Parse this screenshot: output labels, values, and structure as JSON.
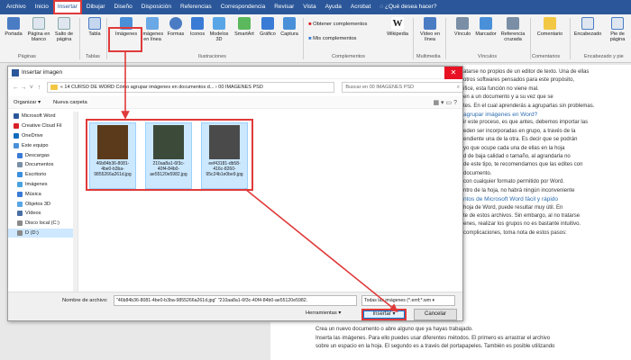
{
  "ribbon": {
    "tabs": [
      "Archivo",
      "Inicio",
      "Insertar",
      "Dibujar",
      "Diseño",
      "Disposición",
      "Referencias",
      "Correspondencia",
      "Revisar",
      "Vista",
      "Ayuda",
      "Acrobat"
    ],
    "active_tab": "Insertar",
    "tell_me": "¿Qué desea hacer?",
    "buttons": {
      "portada": "Portada",
      "pagina_blanco": "Página en blanco",
      "salto_pagina": "Salto de página",
      "tabla": "Tabla",
      "imagenes": "Imágenes",
      "imagenes_linea": "Imágenes en línea",
      "formas": "Formas",
      "iconos": "Iconos",
      "modelos3d": "Modelos 3D",
      "smartart": "SmartArt",
      "grafico": "Gráfico",
      "captura": "Captura",
      "obtener": "Obtener complementos",
      "mis": "Mis complementos",
      "wikipedia": "Wikipedia",
      "video": "Vídeo en línea",
      "vinculo": "Vínculo",
      "marcador": "Marcador",
      "referencia": "Referencia cruzada",
      "comentario": "Comentario",
      "encabezado": "Encabezado",
      "pie": "Pie de página"
    },
    "groups": {
      "paginas": "Páginas",
      "tablas": "Tablas",
      "ilustraciones": "Ilustraciones",
      "complementos": "Complementos",
      "multimedia": "Multimedia",
      "vinculos": "Vínculos",
      "comentarios": "Comentarios",
      "encabezado": "Encabezado y pie"
    }
  },
  "dialog": {
    "title": "Insertar imagen",
    "close": "✕",
    "address": "« 14 CURSO DE WORD Cómo agrupar imágenes en documentos d...  ›  00 IMAGENES PSD",
    "search_placeholder": "Buscar en 00 IMAGENES PSD",
    "toolbar": {
      "organize": "Organizar ▾",
      "new_folder": "Nueva carpeta"
    },
    "nav_items": [
      {
        "label": "Microsoft Word",
        "icon": "word-icon",
        "color": "#2b579a"
      },
      {
        "label": "Creative Cloud Fil",
        "icon": "cloud-icon",
        "color": "#da1f26"
      },
      {
        "label": "OneDrive",
        "icon": "onedrive-icon",
        "color": "#0f6cbd"
      },
      {
        "label": "Este equipo",
        "icon": "computer-icon",
        "color": "#4a90d9"
      },
      {
        "label": "Descargas",
        "icon": "download-icon",
        "color": "#3a7bd5"
      },
      {
        "label": "Documentos",
        "icon": "documents-icon",
        "color": "#7a8fa6"
      },
      {
        "label": "Escritorio",
        "icon": "desktop-icon",
        "color": "#3a8fe0"
      },
      {
        "label": "Imágenes",
        "icon": "pictures-icon",
        "color": "#4aa3df"
      },
      {
        "label": "Música",
        "icon": "music-icon",
        "color": "#3a7bd5"
      },
      {
        "label": "Objetos 3D",
        "icon": "cube-icon",
        "color": "#58a6e6"
      },
      {
        "label": "Vídeos",
        "icon": "video-icon",
        "color": "#4a6fa5"
      },
      {
        "label": "Disco local (C:)",
        "icon": "drive-icon",
        "color": "#8a8a8a"
      },
      {
        "label": "D (D:)",
        "icon": "drive-icon",
        "color": "#8a8a8a"
      }
    ],
    "files": [
      {
        "name": "46b84b36-8081-4be0-b3ba-9855266a261d.jpg",
        "color": "#5a3a1a"
      },
      {
        "name": "210aa8a1-6f3c-40f4-84b0-ae55120e5982.jpg",
        "color": "#3c4a3a"
      },
      {
        "name": "eef43181-db58-416c-8260-95c24b1e0be9.jpg",
        "color": "#4a4a4a"
      }
    ],
    "filename_label": "Nombre de archivo:",
    "filename_value": "\"46b84b36-8081-4be0-b3ba-9855266a261d.jpg\" \"210aa8a1-6f3c-40f4-84b0-ae55120e5982.",
    "filetype_value": "Todas las imágenes (*.emf;*.wm ▾",
    "tools_label": "Herramientas  ▾",
    "insert_label": "Insertar",
    "cancel_label": "Cancelar"
  },
  "document": {
    "paragraphs": [
      "atarse no propios de un editor de texto. Una de ellas",
      "otros softwares pensados para este propósito,",
      "ifice, esta función no viene mal.",
      "",
      "en a un documento y a su vez que se",
      "tes. En el cual aprenderás a agruparlas sin problemas.",
      "",
      "agrupar imágenes en Word?",
      "ir este proceso, es que antes, debemos importar las",
      "eden ser incorporadas en grupo, a través de la",
      "endiente una de la otra. Es decir que se podrán",
      "yo que ocupe cada una de ellas en la hoja",
      "",
      "d de baja calidad o tamaño, al agrandarla no",
      "de este tipo, te recomendamos que las edites con",
      "documento.",
      "",
      "con cualquier formato permitido por Word.",
      "ntro de la hoja, no habrá ningún inconveniente",
      "",
      "ntos de Microsoft Word fácil y rápido",
      "hoja de Word, puede resultar muy útil. En",
      "te de estos archivos. Sin embargo, al no tratarse",
      "enes, realizar los grupos no es bastante intuitivo.",
      "complicaciones, toma nota de estos pasos:"
    ],
    "bottom_lines": [
      "Crea un nuevo documento o abre alguno que ya hayas trabajado.",
      "Inserta las imágenes. Para ello puedes usar diferentes métodos. El primero es arrastrar el archivo",
      "sobre un espacio en la hoja. El segundo es a través del portapapeles. También es posible utilizando"
    ]
  }
}
